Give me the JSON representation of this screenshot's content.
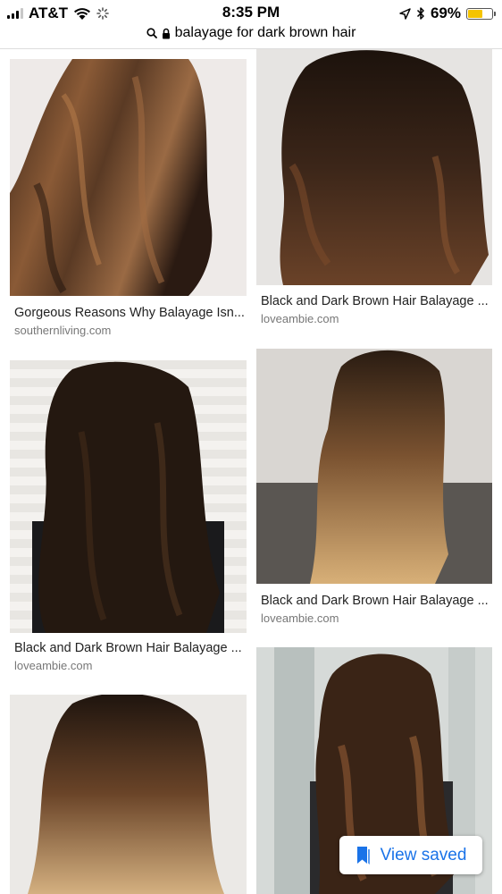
{
  "status_bar": {
    "carrier": "AT&T",
    "time": "8:35 PM",
    "battery_percent_text": "69%",
    "battery_level": 0.69,
    "signal_bars": 3,
    "icons": [
      "signal-icon",
      "wifi-icon",
      "loading-icon",
      "location-icon",
      "bluetooth-icon",
      "battery-icon"
    ]
  },
  "url_bar": {
    "query": "balayage for dark brown hair",
    "icons": [
      "search-icon",
      "lock-icon"
    ]
  },
  "results": [
    {
      "title": "Gorgeous Reasons Why Balayage Isn...",
      "source": "southernliving.com"
    },
    {
      "title": "Black and Dark Brown Hair Balayage ...",
      "source": "loveambie.com"
    },
    {
      "title": "Black and Dark Brown Hair Balayage ...",
      "source": "loveambie.com"
    },
    {
      "title": "Black and Dark Brown Hair Balayage ...",
      "source": "loveambie.com"
    },
    {
      "title": "",
      "source": ""
    },
    {
      "title": "",
      "source": ""
    }
  ],
  "view_saved": {
    "label": "View saved",
    "icon": "bookmark-icon",
    "accent_color": "#1a73e8"
  }
}
